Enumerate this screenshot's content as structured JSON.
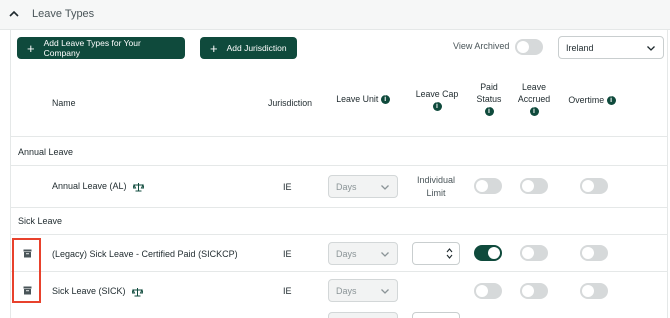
{
  "section": {
    "title": "Leave Types"
  },
  "toolbar": {
    "add_leave_types_label": "Add Leave Types for Your Company",
    "add_jurisdiction_label": "Add Jurisdiction",
    "view_archived_label": "View Archived",
    "view_archived_on": false,
    "country_value": "Ireland"
  },
  "columns": {
    "name": "Name",
    "jurisdiction": "Jurisdiction",
    "leave_unit": "Leave Unit",
    "leave_cap": "Leave Cap",
    "paid_status_1": "Paid",
    "paid_status_2": "Status",
    "leave_accrued_1": "Leave",
    "leave_accrued_2": "Accrued",
    "overtime": "Overtime"
  },
  "groups": [
    {
      "label": "Annual Leave",
      "rows": [
        {
          "name": "Annual Leave (AL)",
          "jurisdiction": "IE",
          "unit": "Days",
          "cap_line1": "Individual",
          "cap_line2": "Limit",
          "paid": false,
          "accrued": false,
          "overtime": false
        }
      ]
    },
    {
      "label": "Sick Leave",
      "rows": [
        {
          "name": "(Legacy) Sick Leave - Certified Paid (SICKCP)",
          "jurisdiction": "IE",
          "unit": "Days",
          "cap_value": "",
          "paid": true,
          "accrued": false,
          "overtime": false
        },
        {
          "name": "Sick Leave (SICK)",
          "jurisdiction": "IE",
          "unit": "Days",
          "paid": false,
          "accrued": false,
          "overtime": false
        }
      ]
    }
  ],
  "colors": {
    "primary": "#0f4a3c",
    "toggle_off": "#d6d9da",
    "highlight": "#e8412c"
  },
  "icons": [
    "chevron-up-icon",
    "plus-icon",
    "chevron-down-icon",
    "info-icon",
    "balance-scale-icon",
    "archive-icon",
    "stepper-arrows-icon"
  ]
}
